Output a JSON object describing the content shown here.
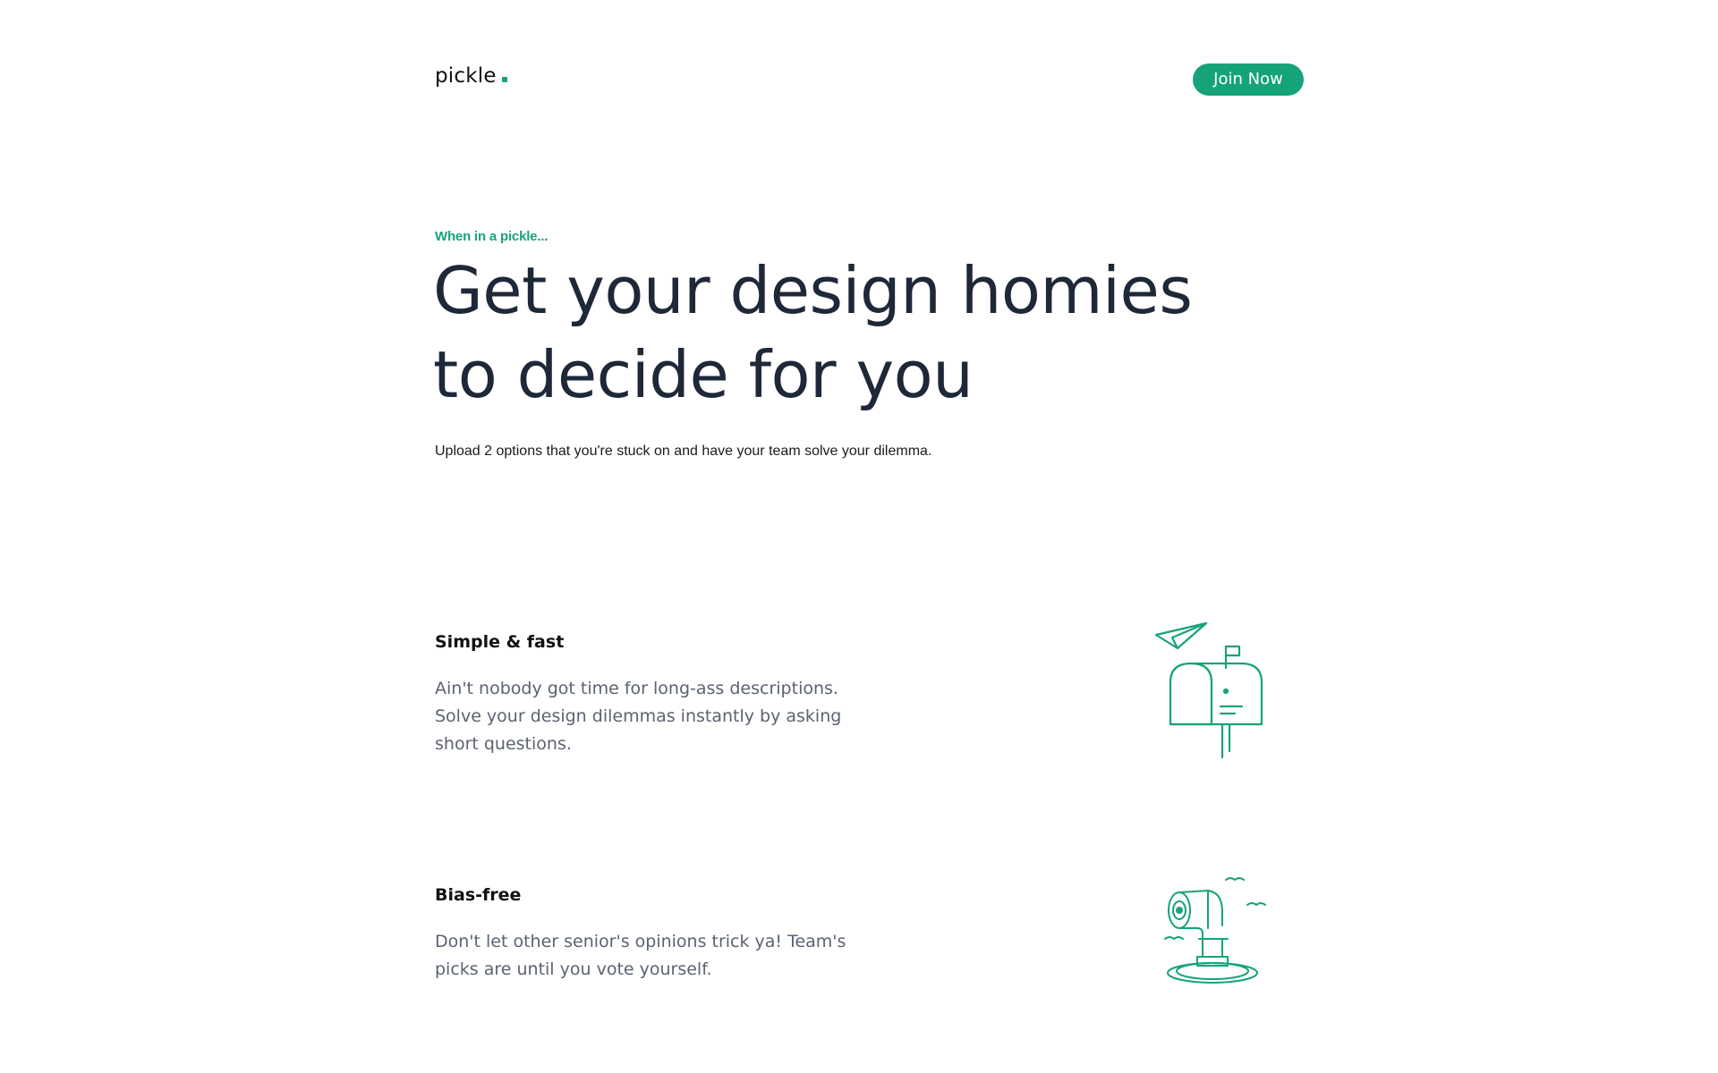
{
  "header": {
    "logo_text": "pickle",
    "join_label": "Join Now"
  },
  "hero": {
    "eyebrow": "When in a pickle...",
    "title_line1": "Get your design homies",
    "title_line2": "to decide for you",
    "subtitle": "Upload 2 options that you're stuck on and have your team solve your dilemma."
  },
  "features": [
    {
      "title": "Simple & fast",
      "desc_line1": "Ain't nobody got time for long-ass descriptions.",
      "desc_line2": "Solve your design dilemmas instantly by asking",
      "desc_line3": "short questions.",
      "icon": "mailbox-paper-plane-icon"
    },
    {
      "title": "Bias-free",
      "desc_line1": "Don't let other senior's opinions trick ya! Team's",
      "desc_line2": "picks are until you vote yourself.",
      "icon": "periscope-icon"
    }
  ],
  "colors": {
    "accent": "#16a37a",
    "heading": "#1e2838",
    "body": "#5b6270"
  }
}
